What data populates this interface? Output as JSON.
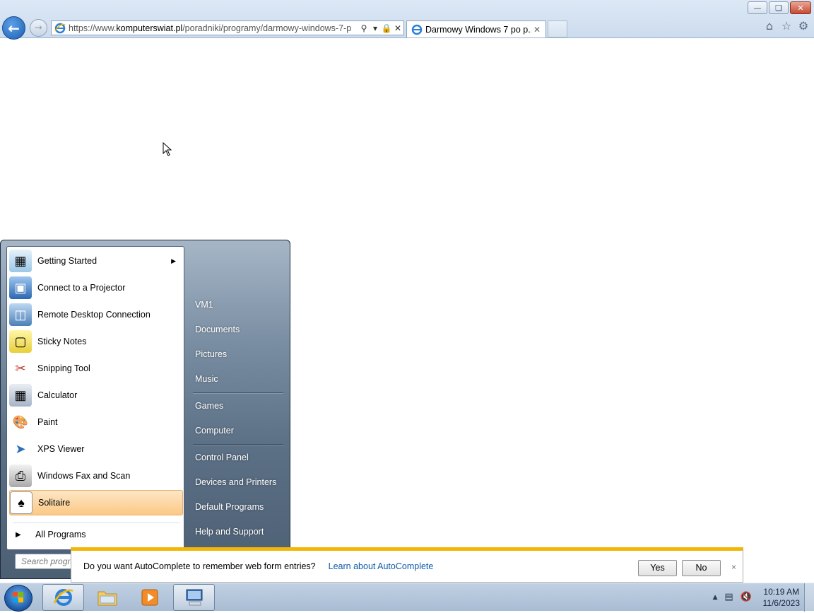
{
  "browser": {
    "address_url_prefix": "https://www.",
    "address_url_host": "komputerswiat.pl",
    "address_url_path": "/poradniki/programy/darmowy-windows-7-p",
    "tab_title": "Darmowy Windows 7 po p...",
    "icons": [
      "back-arrow-icon",
      "forward-arrow-icon",
      "ie-page-icon",
      "search-icon",
      "dropdown-icon",
      "lock-icon",
      "stop-icon",
      "home-icon",
      "favorites-star-icon",
      "tools-gear-icon"
    ]
  },
  "start_menu": {
    "programs": [
      {
        "label": "Getting Started",
        "icon": "getting-started-icon",
        "has_submenu": true
      },
      {
        "label": "Connect to a Projector",
        "icon": "projector-icon"
      },
      {
        "label": "Remote Desktop Connection",
        "icon": "remote-desktop-icon"
      },
      {
        "label": "Sticky Notes",
        "icon": "sticky-notes-icon"
      },
      {
        "label": "Snipping Tool",
        "icon": "scissors-icon"
      },
      {
        "label": "Calculator",
        "icon": "calculator-icon"
      },
      {
        "label": "Paint",
        "icon": "paint-palette-icon"
      },
      {
        "label": "XPS Viewer",
        "icon": "xps-viewer-icon"
      },
      {
        "label": "Windows Fax and Scan",
        "icon": "fax-icon"
      },
      {
        "label": "Solitaire",
        "icon": "solitaire-cards-icon",
        "selected": true
      }
    ],
    "all_programs": "All Programs",
    "search_placeholder": "Search programs and files",
    "right_column": {
      "user": "VM1",
      "group1": [
        "Documents",
        "Pictures",
        "Music"
      ],
      "group2": [
        "Games",
        "Computer"
      ],
      "group3": [
        "Control Panel",
        "Devices and Printers",
        "Default Programs",
        "Help and Support"
      ]
    }
  },
  "autocomplete_bar": {
    "message": "Do you want AutoComplete to remember web form entries?",
    "link": "Learn about AutoComplete",
    "yes": "Yes",
    "no": "No",
    "close": "×"
  },
  "taskbar": {
    "time": "10:19 AM",
    "date": "11/6/2023",
    "colors": {
      "selected_item": "#fbc985",
      "notification_accent": "#f2b705",
      "link": "#0b5aaa"
    }
  }
}
